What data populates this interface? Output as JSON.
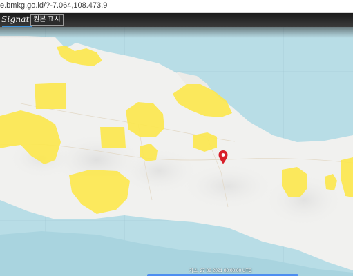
{
  "browser": {
    "url": "e.bmkg.go.id/?-7.064,108.473,9"
  },
  "header": {
    "logo_text": "Signature",
    "toggle_label": "원본 표시"
  },
  "map": {
    "marker": "map-pin-icon",
    "highlight_color": "#fde84d",
    "land_color": "#f2f2f0",
    "sea_color": "#b8dde6"
  },
  "timeline": {
    "current_time": "가스, 27 09 2021 00:00:00 UTC"
  }
}
